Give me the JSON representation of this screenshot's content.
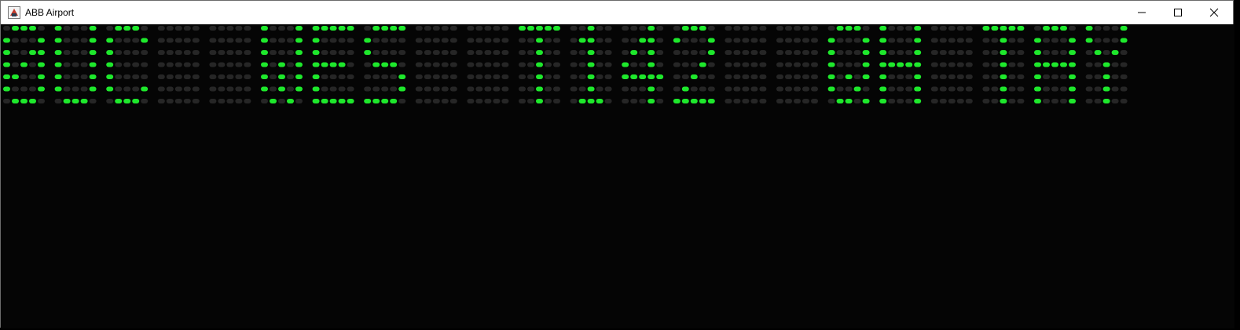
{
  "window": {
    "title": "ABB Airport",
    "controls": [
      {
        "name": "minimize-button",
        "icon": "minimize-icon"
      },
      {
        "name": "maximize-button",
        "icon": "maximize-icon"
      },
      {
        "name": "close-button",
        "icon": "close-icon"
      }
    ]
  },
  "board": {
    "on_color": "#1ee82c",
    "off_color": "#262626",
    "rows": 7,
    "cols_per_char": 5,
    "characters": [
      "0",
      "U",
      "C",
      " ",
      " ",
      "W",
      "E",
      "S",
      " ",
      " ",
      "T",
      "1",
      "4",
      "2",
      " ",
      " ",
      "Q",
      "H",
      " ",
      "T",
      "A",
      "Y"
    ]
  }
}
